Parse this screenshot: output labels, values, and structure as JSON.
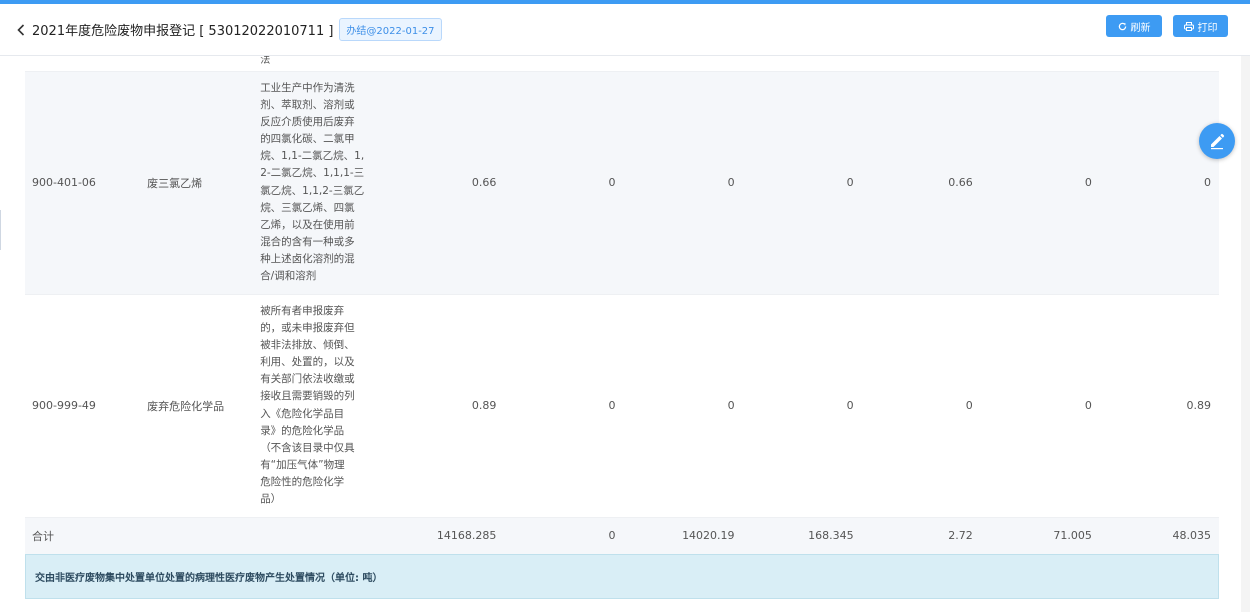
{
  "header": {
    "title": "2021年度危险废物申报登记 [ 53012022010711 ]",
    "tag": "办结@2022-01-27",
    "refresh_label": "刷新",
    "print_label": "打印"
  },
  "table": {
    "fragment_text": "法",
    "rows": [
      {
        "code": "900-401-06",
        "name": "废三氯乙烯",
        "desc_lines": [
          "工业生产中作为清洗",
          "剂、萃取剂、溶剂或",
          "反应介质使用后废弃",
          "的四氯化碳、二氯甲",
          "烷、1,1-二氯乙烷、1,",
          "2-二氯乙烷、1,1,1-三",
          "氯乙烷、1,1,2-三氯乙",
          "烷、三氯乙烯、四氯",
          "乙烯，以及在使用前",
          "混合的含有一种或多",
          "种上述卤化溶剂的混",
          "合/调和溶剂"
        ],
        "values": [
          "0.66",
          "0",
          "0",
          "0",
          "0.66",
          "0",
          "0"
        ]
      },
      {
        "code": "900-999-49",
        "name": "废弃危险化学品",
        "desc_lines": [
          "被所有者申报废弃",
          "的，或未申报废弃但",
          "被非法排放、倾倒、",
          "利用、处置的，以及",
          "有关部门依法收缴或",
          "接收且需要销毁的列",
          "入《危险化学品目",
          "录》的危险化学品",
          "（不含该目录中仅具",
          "有“加压气体”物理",
          "危险性的危险化学",
          "品）"
        ],
        "values": [
          "0.89",
          "0",
          "0",
          "0",
          "0",
          "0",
          "0.89"
        ]
      }
    ],
    "total": {
      "label": "合计",
      "values": [
        "14168.285",
        "0",
        "14020.19",
        "168.345",
        "2.72",
        "71.005",
        "48.035"
      ]
    }
  },
  "section_title": "交由非医疗废物集中处置单位处置的病理性医疗废物产生处置情况（单位: 吨）",
  "colors": {
    "accent": "#3d9bf3",
    "section_bg": "#d9eef6",
    "row_alt": "#f5f7fa"
  },
  "icons": {
    "back": "chevron-left-icon",
    "refresh": "refresh-icon",
    "print": "printer-icon",
    "edit": "pencil-icon"
  }
}
